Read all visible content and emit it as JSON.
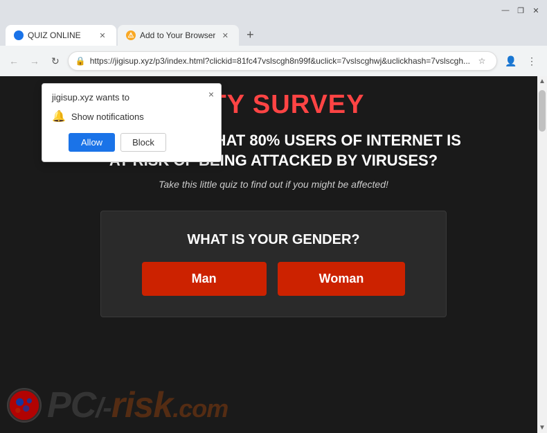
{
  "browser": {
    "tabs": [
      {
        "id": "tab1",
        "label": "QUIZ ONLINE",
        "favicon_type": "blue",
        "active": true
      },
      {
        "id": "tab2",
        "label": "Add to Your Browser",
        "favicon_type": "warning",
        "active": false
      }
    ],
    "new_tab_label": "+",
    "address": "https://jigisup.xyz/p3/index.html?clickid=81fc47vslscgh8n99f&uclick=7vslscghwj&uclickhash=7vslscgh...",
    "nav": {
      "back": "←",
      "forward": "→",
      "refresh": "↻"
    },
    "toolbar": {
      "bookmark": "☆",
      "profile": "👤",
      "menu": "⋮"
    }
  },
  "notification_popup": {
    "title": "jigisup.xyz wants to",
    "close_label": "×",
    "bell_icon": "🔔",
    "notification_text": "Show notifications",
    "allow_label": "Allow",
    "block_label": "Block"
  },
  "survey": {
    "title": "RITY SURVEY",
    "headline": "DID YOU KNOW THAT 80% USERS OF INTERNET IS AT RISK OF BEING ATTACKED BY VIRUSES?",
    "subtext": "Take this little quiz to find out if you might be affected!",
    "gender_section": {
      "question": "WHAT IS YOUR GENDER?",
      "man_label": "Man",
      "woman_label": "Woman"
    }
  },
  "watermark": {
    "logo_letter": "✦",
    "text_pc": "PC",
    "text_slash": "/",
    "text_dash": "-",
    "text_risk": "risk",
    "text_dot_com": ".com"
  },
  "colors": {
    "survey_title": "#ff4444",
    "gender_btn": "#cc2200",
    "browser_bg": "#dee1e6",
    "page_bg": "#1a1a1a"
  }
}
